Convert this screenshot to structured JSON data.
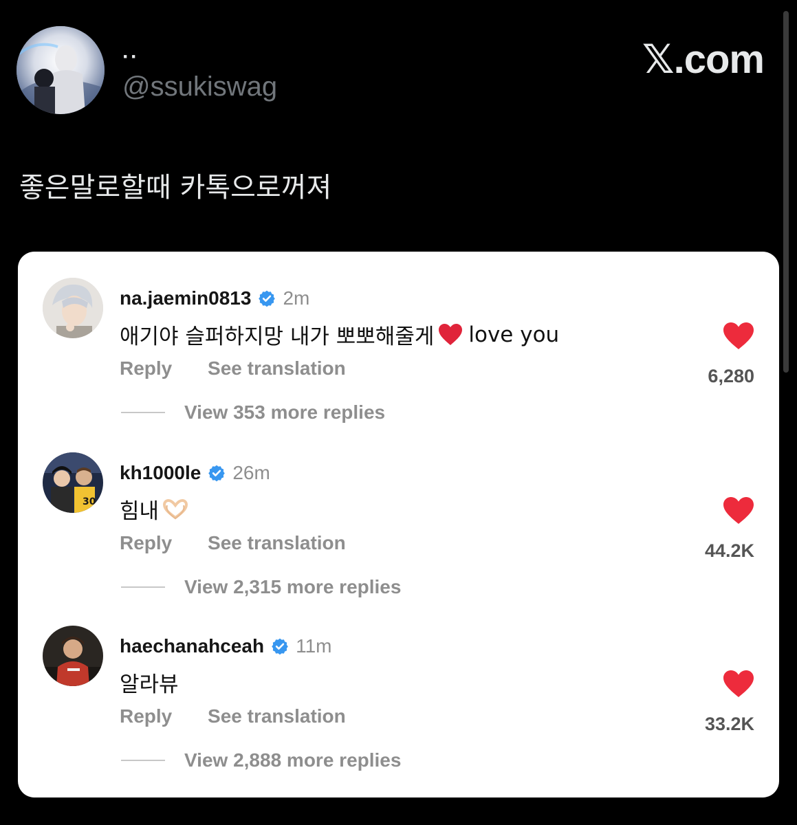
{
  "header": {
    "display_name": "··",
    "handle": "@ssukiswag",
    "brand": "𝕏.com"
  },
  "tweet": {
    "text": "좋은말로할때 카톡으로꺼져"
  },
  "comments": [
    {
      "username": "na.jaemin0813",
      "time": "2m",
      "text": "애기야 슬퍼하지망 내가 뽀뽀해줄게",
      "text_suffix": "love you",
      "reply_label": "Reply",
      "translate_label": "See translation",
      "likes": "6,280",
      "view_more": "View 353 more replies"
    },
    {
      "username": "kh1000le",
      "time": "26m",
      "text": "힘내",
      "reply_label": "Reply",
      "translate_label": "See translation",
      "likes": "44.2K",
      "view_more": "View 2,315 more replies"
    },
    {
      "username": "haechanahceah",
      "time": "11m",
      "text": "알라뷰",
      "reply_label": "Reply",
      "translate_label": "See translation",
      "likes": "33.2K",
      "view_more": "View 2,888 more replies"
    }
  ],
  "colors": {
    "background": "#000000",
    "card": "#ffffff",
    "heart": "#ed2b3c",
    "verified": "#3897f0",
    "muted": "#8e8e8e",
    "handle": "#71767b"
  }
}
